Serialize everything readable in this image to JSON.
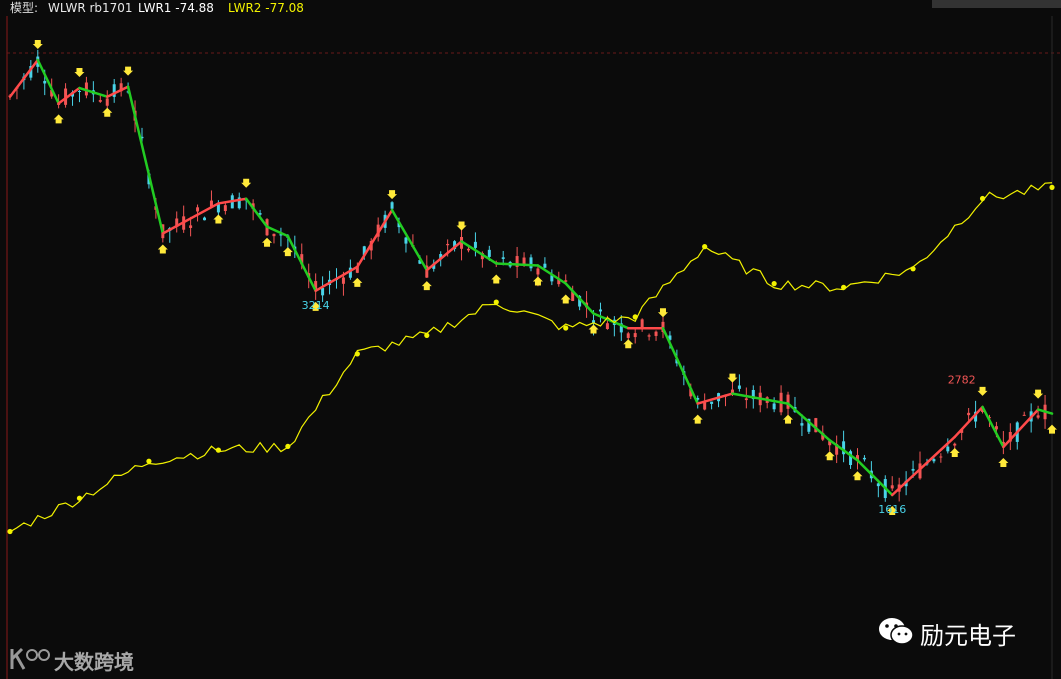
{
  "header": {
    "model_label": "模型:",
    "name": "WLWR rb1701",
    "lwr1": "LWR1 -74.88",
    "lwr2": "LWR2 -77.08"
  },
  "colors": {
    "up": "#f25555",
    "down": "#49d3e8",
    "wave_up": "#ff4a4a",
    "wave_down": "#22cc22",
    "indicator": "#f2f200",
    "marker": "#ffe93a",
    "axis": "#8a1a1a"
  },
  "watermarks": {
    "left_brand": "大数跨境",
    "right_brand": "励元电子"
  },
  "chart_data": [
    {
      "type": "candlestick",
      "title": "",
      "annotations": [
        {
          "label": "3214",
          "kind": "low"
        },
        {
          "label": "1616",
          "kind": "low"
        },
        {
          "label": "2782",
          "kind": "high"
        }
      ],
      "price_range_visible": [
        1616,
        2782
      ],
      "x_count": 150,
      "wave_pivots": [
        {
          "i": 0,
          "v": 3505
        },
        {
          "i": 4,
          "v": 3560
        },
        {
          "i": 7,
          "v": 3495
        },
        {
          "i": 10,
          "v": 3518
        },
        {
          "i": 14,
          "v": 3505
        },
        {
          "i": 17,
          "v": 3520
        },
        {
          "i": 22,
          "v": 3300
        },
        {
          "i": 30,
          "v": 3345
        },
        {
          "i": 34,
          "v": 3352
        },
        {
          "i": 37,
          "v": 3310
        },
        {
          "i": 40,
          "v": 3296
        },
        {
          "i": 44,
          "v": 3214
        },
        {
          "i": 50,
          "v": 3250
        },
        {
          "i": 55,
          "v": 3335
        },
        {
          "i": 60,
          "v": 3245
        },
        {
          "i": 65,
          "v": 3288
        },
        {
          "i": 70,
          "v": 3255
        },
        {
          "i": 76,
          "v": 3252
        },
        {
          "i": 80,
          "v": 3225
        },
        {
          "i": 84,
          "v": 3180
        },
        {
          "i": 89,
          "v": 3158
        },
        {
          "i": 94,
          "v": 3158
        },
        {
          "i": 99,
          "v": 3045
        },
        {
          "i": 104,
          "v": 3060
        },
        {
          "i": 112,
          "v": 3045
        },
        {
          "i": 118,
          "v": 2990
        },
        {
          "i": 122,
          "v": 2960
        },
        {
          "i": 127,
          "v": 2908
        },
        {
          "i": 136,
          "v": 2995
        },
        {
          "i": 140,
          "v": 3040
        },
        {
          "i": 143,
          "v": 2980
        },
        {
          "i": 148,
          "v": 3036
        },
        {
          "i": 150,
          "v": 3030
        }
      ]
    },
    {
      "type": "line",
      "name": "",
      "y_range": [
        0,
        100
      ],
      "x": [
        0,
        10,
        20,
        30,
        40,
        50,
        60,
        70,
        80,
        90,
        100,
        110,
        120,
        130,
        140,
        150
      ],
      "values": [
        5,
        14,
        24,
        27,
        28,
        53,
        58,
        67,
        60,
        63,
        82,
        72,
        71,
        76,
        95,
        98
      ]
    }
  ]
}
